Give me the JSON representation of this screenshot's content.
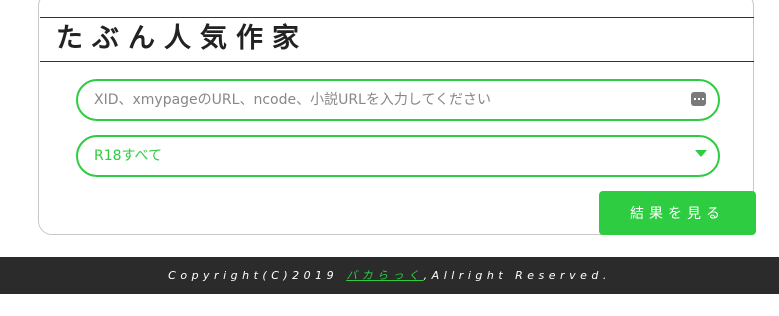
{
  "header": {
    "title": "たぶん人気作家"
  },
  "search": {
    "placeholder": "XID、xmypageのURL、ncode、小説URLを入力してください",
    "value": ""
  },
  "filter": {
    "selected": "R18すべて"
  },
  "actions": {
    "submit_label": "結果を見る"
  },
  "footer": {
    "prefix": "Copyright(C)2019 ",
    "link_text": "バカらっく",
    "suffix": ",Allright Reserved."
  },
  "colors": {
    "accent": "#2ecc40",
    "footer_bg": "#2b2b2b"
  },
  "icons": {
    "search_field_icon": "keypad-icon",
    "select_icon": "chevron-down-icon"
  }
}
